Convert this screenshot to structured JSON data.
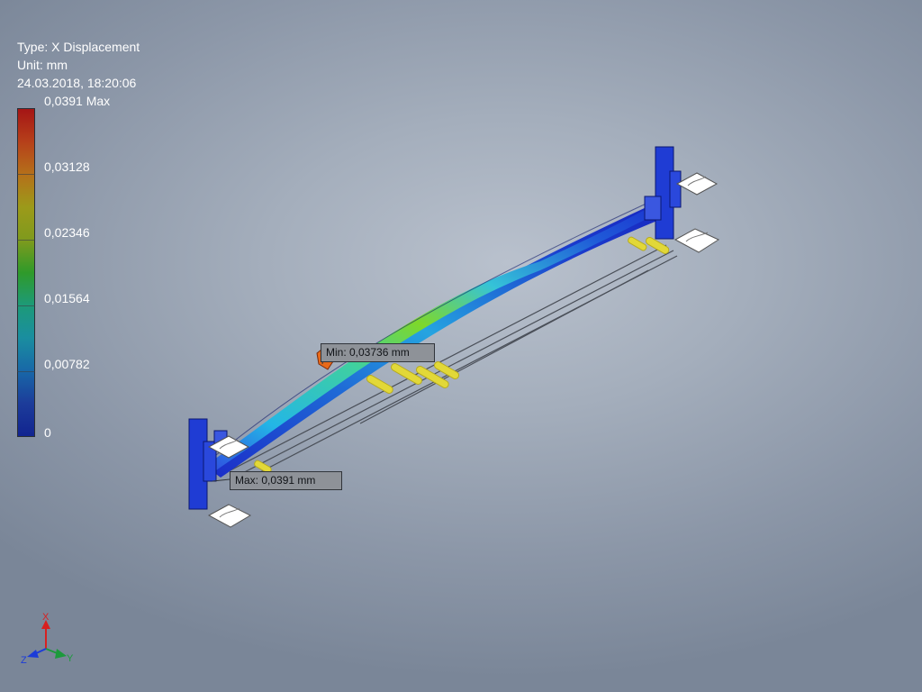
{
  "legend": {
    "type_line": "Type: X Displacement",
    "unit_line": "Unit: mm",
    "timestamp": "24.03.2018, 18:20:06",
    "ticks": [
      "0,0391 Max",
      "0,03128",
      "0,02346",
      "0,01564",
      "0,00782",
      "0"
    ]
  },
  "probes": {
    "min_label": "Min: 0,03736 mm",
    "max_label": "Max: 0,0391 mm"
  },
  "triad": {
    "x": "X",
    "y": "Y",
    "z": "Z"
  },
  "colors": {
    "max": "#a51515",
    "min": "#122490",
    "load_arrow": "#e2d838",
    "frame_blue": "#1f3cd4"
  }
}
